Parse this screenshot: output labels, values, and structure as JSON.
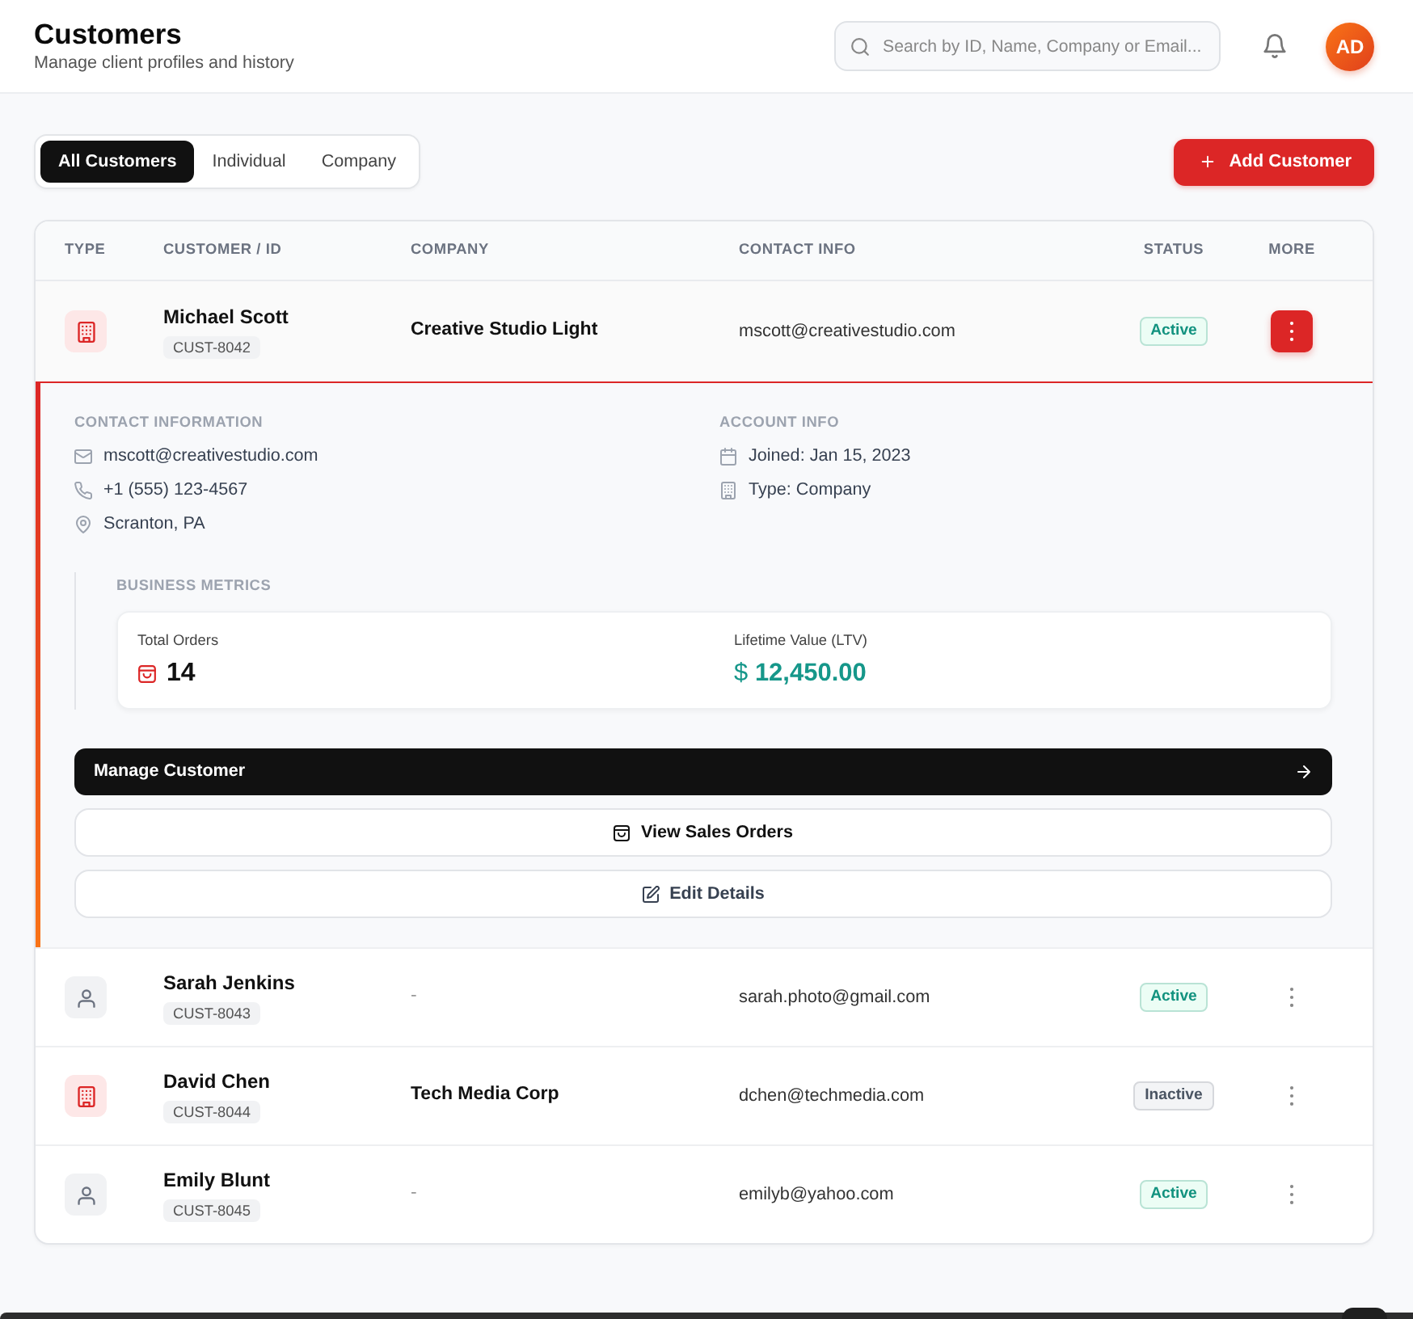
{
  "header": {
    "title": "Customers",
    "subtitle": "Manage client profiles and history",
    "search": {
      "placeholder": "Search by ID, Name, Company or Email..."
    },
    "avatar": "AD"
  },
  "filter_tabs": [
    {
      "label": "All Customers",
      "selected": true
    },
    {
      "label": "Individual",
      "selected": false
    },
    {
      "label": "Company",
      "selected": false
    }
  ],
  "add_button": {
    "label": "Add Customer"
  },
  "table": {
    "columns": [
      "TYPE",
      "CUSTOMER / ID",
      "COMPANY",
      "CONTACT INFO",
      "STATUS",
      "MORE"
    ],
    "rows": [
      {
        "kind": "company",
        "name": "Michael Scott",
        "id": "CUST-8042",
        "company": "Creative Studio Light",
        "email": "mscott@creativestudio.com",
        "status": {
          "kind": "active",
          "label": "Active"
        },
        "expanded": true,
        "details": {
          "contact_information": {
            "title": "CONTACT INFORMATION",
            "items": [
              {
                "kind": "email",
                "text": "mscott@creativestudio.com"
              },
              {
                "kind": "phone",
                "text": "+1 (555) 123-4567"
              },
              {
                "kind": "location",
                "text": "Scranton, PA"
              }
            ]
          },
          "account_info": {
            "title": "ACCOUNT INFO",
            "items": [
              {
                "kind": "calendar",
                "text": "Joined: Jan 15, 2023"
              },
              {
                "kind": "building",
                "text": "Type: Company"
              }
            ]
          },
          "business_metrics": {
            "title": "BUSINESS METRICS",
            "metrics": [
              {
                "kind": "orders",
                "label": "Total Orders",
                "value": "14"
              },
              {
                "kind": "currency",
                "label": "Lifetime Value (LTV)",
                "value": "$ **12,450.00**"
              }
            ]
          },
          "actions": [
            {
              "kind": "primary",
              "label": "Manage Customer"
            },
            {
              "kind": "orders",
              "label": "View Sales Orders"
            },
            {
              "kind": "edit",
              "label": "Edit Details"
            }
          ]
        }
      },
      {
        "kind": "individual",
        "name": "Sarah Jenkins",
        "id": "CUST-8043",
        "company": "-",
        "email": "sarah.photo@gmail.com",
        "status": {
          "kind": "active",
          "label": "Active"
        },
        "expanded": false
      },
      {
        "kind": "company",
        "name": "David Chen",
        "id": "CUST-8044",
        "company": "Tech Media Corp",
        "email": "dchen@techmedia.com",
        "status": {
          "kind": "inactive",
          "label": "Inactive"
        },
        "expanded": false
      },
      {
        "kind": "individual",
        "name": "Emily Blunt",
        "id": "CUST-8045",
        "company": "-",
        "email": "emilyb@yahoo.com",
        "status": {
          "kind": "active",
          "label": "Active"
        },
        "expanded": false
      }
    ]
  }
}
